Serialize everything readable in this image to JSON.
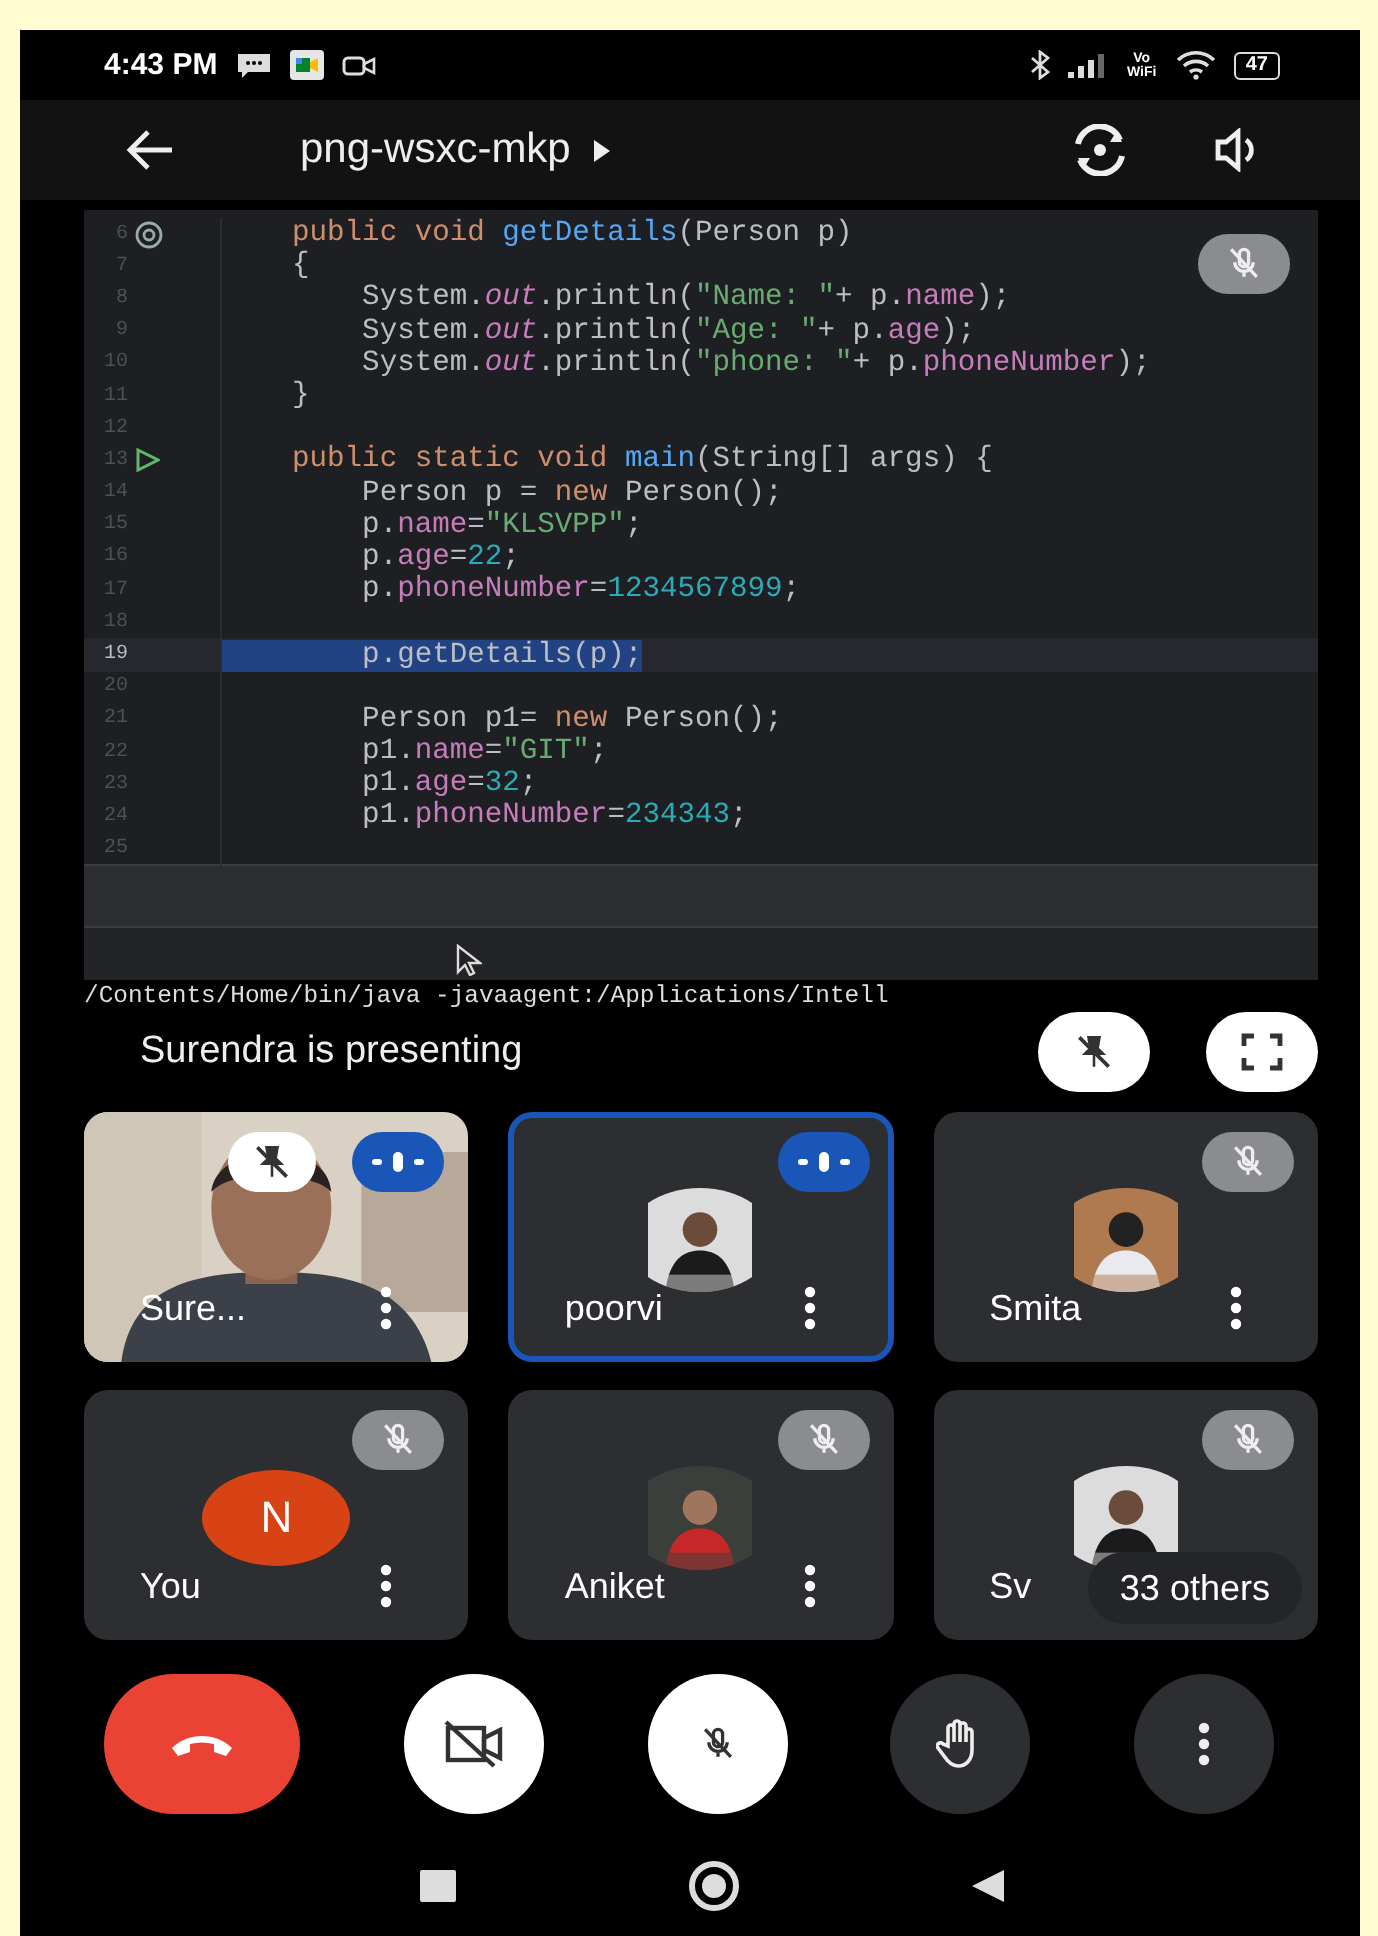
{
  "status_bar": {
    "time": "4:43 PM",
    "vowifi": "Vo WiFi",
    "battery": "47"
  },
  "header": {
    "title": "png-wsxc-mkp"
  },
  "presentation": {
    "muted": true,
    "lines": [
      {
        "number": "6",
        "overridden": true,
        "selected": false,
        "segments": [
          {
            "text": "    public void ",
            "kind": "keyword"
          },
          {
            "text": "getDetails",
            "kind": "method"
          },
          {
            "text": "(Person p)",
            "kind": "plain"
          }
        ]
      },
      {
        "number": "7",
        "selected": false,
        "segments": [
          {
            "text": "    {",
            "kind": "plain"
          }
        ]
      },
      {
        "number": "8",
        "selected": false,
        "segments": [
          {
            "text": "        System.",
            "kind": "plain"
          },
          {
            "text": "out",
            "kind": "static"
          },
          {
            "text": ".println(",
            "kind": "plain"
          },
          {
            "text": "\"Name: \"",
            "kind": "string"
          },
          {
            "text": "+ p.",
            "kind": "plain"
          },
          {
            "text": "name",
            "kind": "field"
          },
          {
            "text": ");",
            "kind": "plain"
          }
        ]
      },
      {
        "number": "9",
        "selected": false,
        "segments": [
          {
            "text": "        System.",
            "kind": "plain"
          },
          {
            "text": "out",
            "kind": "static"
          },
          {
            "text": ".println(",
            "kind": "plain"
          },
          {
            "text": "\"Age: \"",
            "kind": "string"
          },
          {
            "text": "+ p.",
            "kind": "plain"
          },
          {
            "text": "age",
            "kind": "field"
          },
          {
            "text": ");",
            "kind": "plain"
          }
        ]
      },
      {
        "number": "10",
        "selected": false,
        "segments": [
          {
            "text": "        System.",
            "kind": "plain"
          },
          {
            "text": "out",
            "kind": "static"
          },
          {
            "text": ".println(",
            "kind": "plain"
          },
          {
            "text": "\"phone: \"",
            "kind": "string"
          },
          {
            "text": "+ p.",
            "kind": "plain"
          },
          {
            "text": "phoneNumber",
            "kind": "field"
          },
          {
            "text": ");",
            "kind": "plain"
          }
        ]
      },
      {
        "number": "11",
        "selected": false,
        "segments": [
          {
            "text": "    }",
            "kind": "plain"
          }
        ]
      },
      {
        "number": "12",
        "selected": false
      },
      {
        "number": "13",
        "runnable": true,
        "selected": false,
        "segments": [
          {
            "text": "    public static void ",
            "kind": "keyword"
          },
          {
            "text": "main",
            "kind": "method"
          },
          {
            "text": "(String[] args) {",
            "kind": "plain"
          }
        ]
      },
      {
        "number": "14",
        "selected": false,
        "segments": [
          {
            "text": "        Person p = ",
            "kind": "plain"
          },
          {
            "text": "new ",
            "kind": "keyword"
          },
          {
            "text": "Person();",
            "kind": "plain"
          }
        ]
      },
      {
        "number": "15",
        "selected": false,
        "segments": [
          {
            "text": "        p.",
            "kind": "plain"
          },
          {
            "text": "name",
            "kind": "field"
          },
          {
            "text": "=",
            "kind": "plain"
          },
          {
            "text": "\"KLSVPP\"",
            "kind": "string"
          },
          {
            "text": ";",
            "kind": "plain"
          }
        ]
      },
      {
        "number": "16",
        "selected": false,
        "segments": [
          {
            "text": "        p.",
            "kind": "plain"
          },
          {
            "text": "age",
            "kind": "field"
          },
          {
            "text": "=",
            "kind": "plain"
          },
          {
            "text": "22",
            "kind": "number"
          },
          {
            "text": ";",
            "kind": "plain"
          }
        ]
      },
      {
        "number": "17",
        "selected": false,
        "segments": [
          {
            "text": "        p.",
            "kind": "plain"
          },
          {
            "text": "phoneNumber",
            "kind": "field"
          },
          {
            "text": "=",
            "kind": "plain"
          },
          {
            "text": "1234567899",
            "kind": "number"
          },
          {
            "text": ";",
            "kind": "plain"
          }
        ]
      },
      {
        "number": "18",
        "selected": false
      },
      {
        "number": "19",
        "selected": true,
        "segments": [
          {
            "text": "        p.getDetails(p);",
            "kind": "plain"
          }
        ]
      },
      {
        "number": "20",
        "selected": false
      },
      {
        "number": "21",
        "selected": false,
        "segments": [
          {
            "text": "        Person p1= ",
            "kind": "plain"
          },
          {
            "text": "new ",
            "kind": "keyword"
          },
          {
            "text": "Person();",
            "kind": "plain"
          }
        ]
      },
      {
        "number": "22",
        "selected": false,
        "segments": [
          {
            "text": "        p1.",
            "kind": "plain"
          },
          {
            "text": "name",
            "kind": "field"
          },
          {
            "text": "=",
            "kind": "plain"
          },
          {
            "text": "\"GIT\"",
            "kind": "string"
          },
          {
            "text": ";",
            "kind": "plain"
          }
        ]
      },
      {
        "number": "23",
        "selected": false,
        "segments": [
          {
            "text": "        p1.",
            "kind": "plain"
          },
          {
            "text": "age",
            "kind": "field"
          },
          {
            "text": "=",
            "kind": "plain"
          },
          {
            "text": "32",
            "kind": "number"
          },
          {
            "text": ";",
            "kind": "plain"
          }
        ]
      },
      {
        "number": "24",
        "selected": false,
        "segments": [
          {
            "text": "        p1.",
            "kind": "plain"
          },
          {
            "text": "phoneNumber",
            "kind": "field"
          },
          {
            "text": "=",
            "kind": "plain"
          },
          {
            "text": "234343",
            "kind": "number"
          },
          {
            "text": ";",
            "kind": "plain"
          }
        ]
      },
      {
        "number": "25",
        "selected": false
      }
    ],
    "terminal": "/Contents/Home/bin/java -javaagent:/Applications/Intell",
    "presenter_label": "Surendra is presenting"
  },
  "participants": [
    {
      "name": "Sure...",
      "muted": false,
      "pinned": true,
      "selected": false,
      "avatar": {
        "kind": "video"
      }
    },
    {
      "name": "poorvi",
      "muted": false,
      "pinned": false,
      "selected": true
    },
    {
      "name": "Smita",
      "muted": true,
      "pinned": false,
      "selected": false
    },
    {
      "name": "You",
      "muted": true,
      "pinned": false,
      "selected": false,
      "avatar": {
        "kind": "letter",
        "letter": "N",
        "color": "#d84315"
      }
    },
    {
      "name": "Aniket",
      "muted": true,
      "pinned": false,
      "selected": false
    },
    {
      "name": "Sv",
      "muted": true,
      "pinned": false,
      "selected": false,
      "others": "33 others"
    }
  ]
}
